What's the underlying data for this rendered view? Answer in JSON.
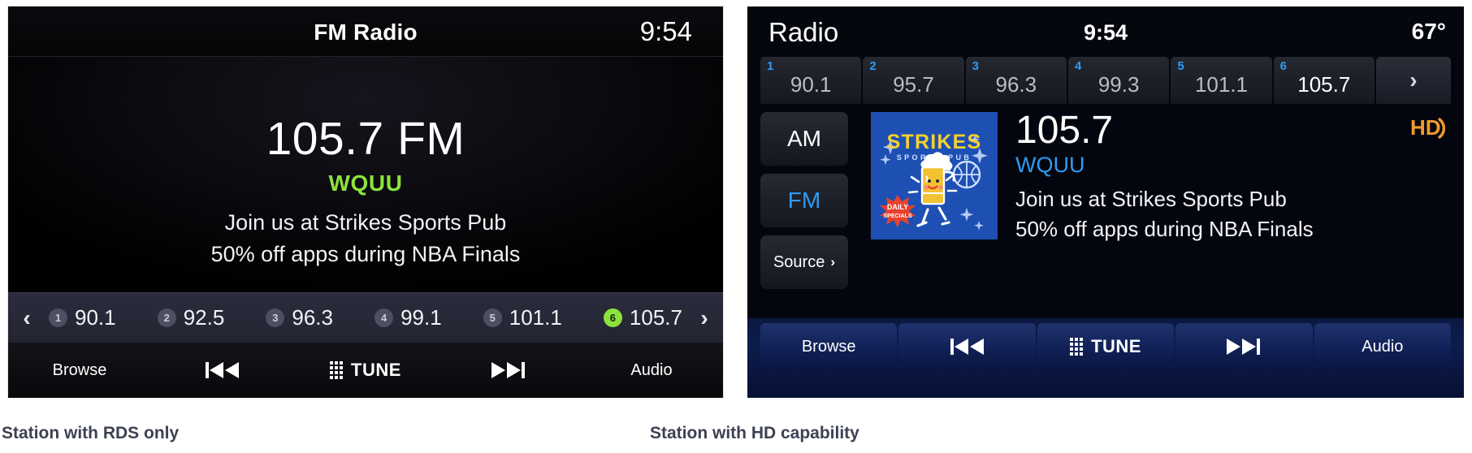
{
  "left_panel": {
    "header": {
      "title": "FM Radio",
      "clock": "9:54"
    },
    "now_playing": {
      "frequency": "105.7 FM",
      "call_sign": "WQUU",
      "call_sign_color": "#8ce23c",
      "rds_line1": "Join us at Strikes Sports Pub",
      "rds_line2": "50% off apps during NBA Finals"
    },
    "presets": {
      "prev_arrow": "‹",
      "next_arrow": "›",
      "items": [
        {
          "number": "1",
          "frequency": "90.1",
          "active": false
        },
        {
          "number": "2",
          "frequency": "92.5",
          "active": false
        },
        {
          "number": "3",
          "frequency": "96.3",
          "active": false
        },
        {
          "number": "4",
          "frequency": "99.1",
          "active": false
        },
        {
          "number": "5",
          "frequency": "101.1",
          "active": false
        },
        {
          "number": "6",
          "frequency": "105.7",
          "active": true
        }
      ],
      "active_color": "#8ce23c"
    },
    "footer": {
      "browse": "Browse",
      "tune": "TUNE",
      "audio": "Audio"
    }
  },
  "right_panel": {
    "header": {
      "title": "Radio",
      "clock": "9:54",
      "temperature": "67°"
    },
    "presets": {
      "items": [
        {
          "number": "1",
          "frequency": "90.1",
          "active": false
        },
        {
          "number": "2",
          "frequency": "95.7",
          "active": false
        },
        {
          "number": "3",
          "frequency": "96.3",
          "active": false
        },
        {
          "number": "4",
          "frequency": "99.3",
          "active": false
        },
        {
          "number": "5",
          "frequency": "101.1",
          "active": false
        },
        {
          "number": "6",
          "frequency": "105.7",
          "active": true
        }
      ],
      "next_arrow": "›",
      "number_color": "#2f9bf0"
    },
    "side_buttons": {
      "am": "AM",
      "fm": "FM",
      "source": "Source",
      "source_chevron": "›",
      "active_color": "#2f9bf0"
    },
    "album_art": {
      "title": "STRIKES",
      "subtitle": "SPORTS PUB",
      "badge_line1": "DAILY",
      "badge_line2": "SPECIALS",
      "background_color": "#1e50b4",
      "title_color": "#f5d02e",
      "badge_color": "#e8412c"
    },
    "now_playing": {
      "frequency": "105.7",
      "call_sign": "WQUU",
      "call_sign_color": "#2f9bf0",
      "rds_line1": "Join us at Strikes Sports Pub",
      "rds_line2": "50% off apps during NBA Finals"
    },
    "hd_badge": {
      "label": "HD",
      "color": "#f29a2e"
    },
    "footer": {
      "browse": "Browse",
      "tune": "TUNE",
      "audio": "Audio"
    }
  },
  "captions": {
    "left": "Station with RDS only",
    "right": "Station with HD capability"
  }
}
